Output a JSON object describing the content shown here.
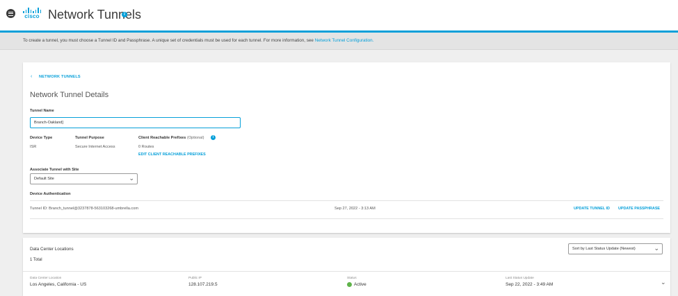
{
  "header": {
    "brand": "cisco",
    "title": "Network Tunnels",
    "accent_color": "#049fd9"
  },
  "banner": {
    "text": "To create a tunnel, you must choose a Tunnel ID and Passphrase. A unique set of credentials must be used for each tunnel. For more information, see ",
    "link": "Network Tunnel Configuration."
  },
  "details": {
    "back_label": "NETWORK TUNNELS",
    "title": "Network Tunnel Details",
    "tunnel_name_label": "Tunnel Name",
    "tunnel_name_value": "Branch-Oakland]",
    "device_type_label": "Device Type",
    "device_type_value": "ISR",
    "tunnel_purpose_label": "Tunnel Purpose",
    "tunnel_purpose_value": "Secure Internet Access",
    "prefixes_label": "Client Reachable Prefixes",
    "prefixes_optional": "(Optional)",
    "prefixes_value": "0 Routes",
    "edit_prefixes_label": "EDIT CLIENT REACHABLE PREFIXES",
    "site_label": "Associate Tunnel with Site",
    "site_value": "Default Site",
    "auth_label": "Device Authentication",
    "tunnel_id": "Tunnel ID: Branch_tunnel@3237878-563103268-umbrella.com",
    "auth_date": "Sep 27, 2022 - 3:13 AM",
    "update_tunnel_id_label": "UPDATE TUNNEL ID",
    "update_passphrase_label": "UPDATE PASSPHRASE"
  },
  "data_centers": {
    "title": "Data Center Locations",
    "total": "1 Total",
    "sort_value": "Sort by Last Status Update (Newest)",
    "columns": {
      "location": "Data Center Location",
      "ip": "Public IP",
      "status": "Status",
      "updated": "Last Status Update"
    },
    "row": {
      "location": "Los Angeles, California - US",
      "ip": "128.107.219.5",
      "status": "Active",
      "status_color": "#5fb34a",
      "updated": "Sep 22, 2022 - 3:49 AM"
    }
  }
}
